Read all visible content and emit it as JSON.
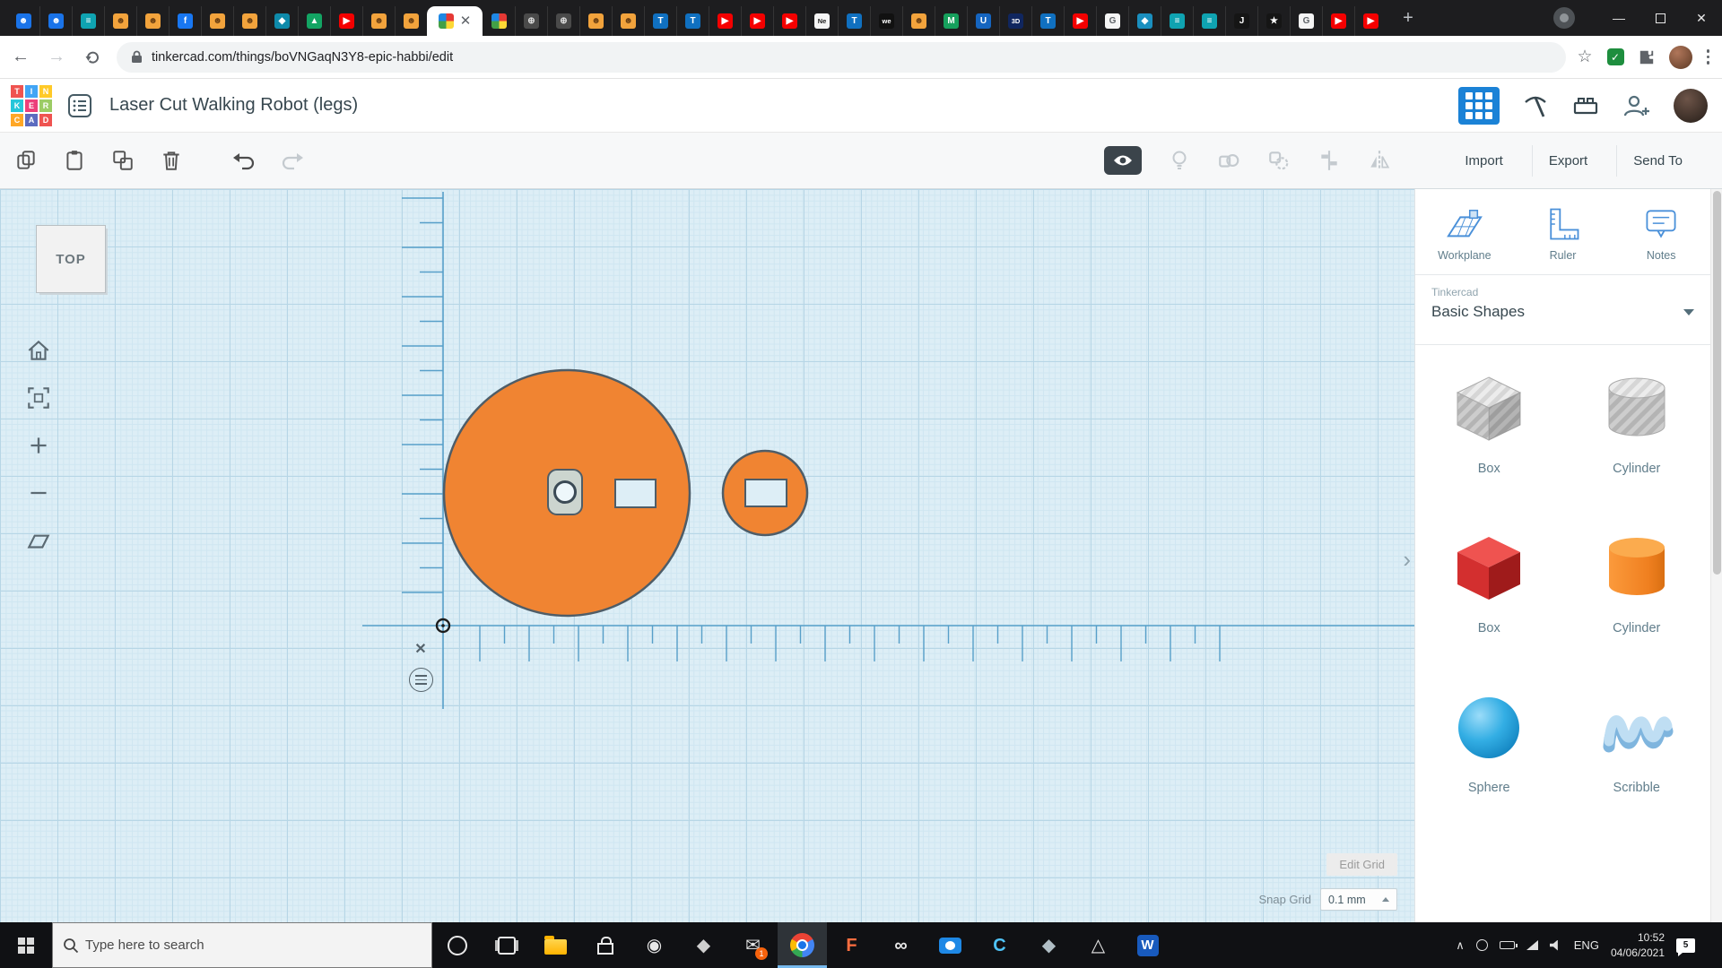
{
  "browser": {
    "url": "tinkercad.com/things/boVNGaqN3Y8-epic-habbi/edit",
    "new_tab": "+",
    "window_controls": {
      "min": "—",
      "close": "✕"
    },
    "tabs": [
      {
        "name": "blue-profile-1",
        "bg": "#1a73e8",
        "fg": "#fff",
        "g": "☻"
      },
      {
        "name": "blue-profile-2",
        "bg": "#1a73e8",
        "fg": "#fff",
        "g": "☻"
      },
      {
        "name": "teal-docs-1",
        "bg": "#0fa3b1",
        "fg": "#fff",
        "g": "≡"
      },
      {
        "name": "avatar-1",
        "bg": "#f2a33c",
        "fg": "#6b3f12",
        "g": "☻"
      },
      {
        "name": "avatar-2",
        "bg": "#f2a33c",
        "fg": "#6b3f12",
        "g": "☻"
      },
      {
        "name": "facebook",
        "bg": "#1877f2",
        "fg": "#fff",
        "g": "f"
      },
      {
        "name": "avatar-3",
        "bg": "#f2a33c",
        "fg": "#6b3f12",
        "g": "☻"
      },
      {
        "name": "avatar-4",
        "bg": "#f2a33c",
        "fg": "#6b3f12",
        "g": "☻"
      },
      {
        "name": "hexagon-teal",
        "bg": "#0e8aaa",
        "fg": "#fff",
        "g": "◆"
      },
      {
        "name": "green-triangle",
        "bg": "#13a463",
        "fg": "#fff",
        "g": "▲"
      },
      {
        "name": "youtube-1",
        "bg": "#f40000",
        "fg": "#fff",
        "g": "▶"
      },
      {
        "name": "avatar-5",
        "bg": "#f2a33c",
        "fg": "#6b3f12",
        "g": "☻"
      },
      {
        "name": "avatar-6",
        "bg": "#f2a33c",
        "fg": "#6b3f12",
        "g": "☻"
      },
      {
        "name": "active-pixel",
        "bg": "quad",
        "active": true
      },
      {
        "name": "pixel-grid",
        "bg": "quad"
      },
      {
        "name": "globe-1",
        "bg": "#4a4a4a",
        "fg": "#ddd",
        "g": "⊕"
      },
      {
        "name": "globe-2",
        "bg": "#4a4a4a",
        "fg": "#ddd",
        "g": "⊕"
      },
      {
        "name": "avatar-7",
        "bg": "#f2a33c",
        "fg": "#6b3f12",
        "g": "☻"
      },
      {
        "name": "avatar-8",
        "bg": "#f2a33c",
        "fg": "#6b3f12",
        "g": "☻"
      },
      {
        "name": "tinkercad-1",
        "bg": "#1070c0",
        "fg": "#fff",
        "g": "T"
      },
      {
        "name": "tinkercad-2",
        "bg": "#1070c0",
        "fg": "#fff",
        "g": "T"
      },
      {
        "name": "youtube-2",
        "bg": "#f40000",
        "fg": "#fff",
        "g": "▶"
      },
      {
        "name": "youtube-3",
        "bg": "#f40000",
        "fg": "#fff",
        "g": "▶"
      },
      {
        "name": "youtube-4",
        "bg": "#f40000",
        "fg": "#fff",
        "g": "▶"
      },
      {
        "name": "ne-tab",
        "bg": "#f5f5f5",
        "fg": "#222",
        "g": "Ne"
      },
      {
        "name": "tinkercad-3",
        "bg": "#1070c0",
        "fg": "#fff",
        "g": "T"
      },
      {
        "name": "wetransfer",
        "bg": "#111",
        "fg": "#fff",
        "g": "we"
      },
      {
        "name": "avatar-9",
        "bg": "#f2a33c",
        "fg": "#6b3f12",
        "g": "☻"
      },
      {
        "name": "green-m",
        "bg": "#16a05d",
        "fg": "#fff",
        "g": "M"
      },
      {
        "name": "u-blue",
        "bg": "#1565c0",
        "fg": "#fff",
        "g": "U"
      },
      {
        "name": "threed-tab",
        "bg": "#10265f",
        "fg": "#fff",
        "g": "3D"
      },
      {
        "name": "tinkercad-4",
        "bg": "#1070c0",
        "fg": "#fff",
        "g": "T"
      },
      {
        "name": "youtube-5",
        "bg": "#f40000",
        "fg": "#fff",
        "g": "▶"
      },
      {
        "name": "google-1",
        "bg": "#f5f5f5",
        "fg": "#5f6368",
        "g": "G"
      },
      {
        "name": "teal-tool",
        "bg": "#1a8fbf",
        "fg": "#fff",
        "g": "◆"
      },
      {
        "name": "teal-docs-2",
        "bg": "#0fa3b1",
        "fg": "#fff",
        "g": "≡"
      },
      {
        "name": "teal-docs-3",
        "bg": "#0fa3b1",
        "fg": "#fff",
        "g": "≡"
      },
      {
        "name": "j-black",
        "bg": "#151515",
        "fg": "#fff",
        "g": "J"
      },
      {
        "name": "star-black",
        "bg": "#151515",
        "fg": "#fff",
        "g": "★"
      },
      {
        "name": "google-2",
        "bg": "#f5f5f5",
        "fg": "#5f6368",
        "g": "G"
      },
      {
        "name": "youtube-6",
        "bg": "#f40000",
        "fg": "#fff",
        "g": "▶"
      },
      {
        "name": "youtube-7",
        "bg": "#f40000",
        "fg": "#fff",
        "g": "▶"
      }
    ]
  },
  "header": {
    "title": "Laser Cut Walking Robot (legs)",
    "logo_tiles": [
      {
        "ch": "T",
        "bg": "#ef5350"
      },
      {
        "ch": "I",
        "bg": "#42a5f5"
      },
      {
        "ch": "N",
        "bg": "#ffca28"
      },
      {
        "ch": "K",
        "bg": "#26c6da"
      },
      {
        "ch": "E",
        "bg": "#ec407a"
      },
      {
        "ch": "R",
        "bg": "#9ccc65"
      },
      {
        "ch": "C",
        "bg": "#ffa726"
      },
      {
        "ch": "A",
        "bg": "#5c6bc0"
      },
      {
        "ch": "D",
        "bg": "#ef5350"
      }
    ]
  },
  "toolbar": {
    "import_label": "Import",
    "export_label": "Export",
    "send_to_label": "Send To"
  },
  "canvas": {
    "viewcube_label": "TOP",
    "edit_grid_label": "Edit Grid",
    "snap_grid_label": "Snap Grid",
    "snap_grid_value": "0.1 mm",
    "shape_color": "#f08432",
    "outline_color": "#4e5d68"
  },
  "panel": {
    "tools": [
      {
        "label": "Workplane"
      },
      {
        "label": "Ruler"
      },
      {
        "label": "Notes"
      }
    ],
    "library_brand": "Tinkercad",
    "library_name": "Basic Shapes",
    "shapes": [
      {
        "label": "Box"
      },
      {
        "label": "Cylinder"
      },
      {
        "label": "Box"
      },
      {
        "label": "Cylinder"
      },
      {
        "label": "Sphere"
      },
      {
        "label": "Scribble"
      }
    ]
  },
  "taskbar": {
    "search_placeholder": "Type here to search",
    "apps": [
      {
        "name": "cortana",
        "kind": "cortana"
      },
      {
        "name": "task-view",
        "kind": "taskview"
      },
      {
        "name": "file-explorer",
        "kind": "folder"
      },
      {
        "name": "microsoft-store",
        "kind": "store"
      },
      {
        "name": "steam",
        "kind": "glyph",
        "g": "◉",
        "c": "#e8e8e8"
      },
      {
        "name": "game-hub",
        "kind": "glyph",
        "g": "◆",
        "c": "#cfcfcf"
      },
      {
        "name": "mail",
        "kind": "glyph",
        "g": "✉",
        "c": "#e8e8e8",
        "badge": "1"
      },
      {
        "name": "chrome",
        "kind": "chrome",
        "active": true
      },
      {
        "name": "fusion-360",
        "kind": "glyph",
        "g": "F",
        "c": "#ff6e40",
        "bold": true
      },
      {
        "name": "recorder",
        "kind": "glyph",
        "g": "∞",
        "c": "#e8e8e8",
        "bold": true
      },
      {
        "name": "camera-app",
        "kind": "camera"
      },
      {
        "name": "capture",
        "kind": "glyph",
        "g": "C",
        "c": "#4fc3f7",
        "bold": true
      },
      {
        "name": "inkscape",
        "kind": "glyph",
        "g": "◆",
        "c": "#b0bec5"
      },
      {
        "name": "cura",
        "kind": "glyph",
        "g": "△",
        "c": "#e8e8e8"
      },
      {
        "name": "word",
        "kind": "word",
        "g": "W"
      }
    ],
    "tray_lang": "ENG",
    "time": "10:52",
    "date": "04/06/2021",
    "notification_count": "5"
  }
}
